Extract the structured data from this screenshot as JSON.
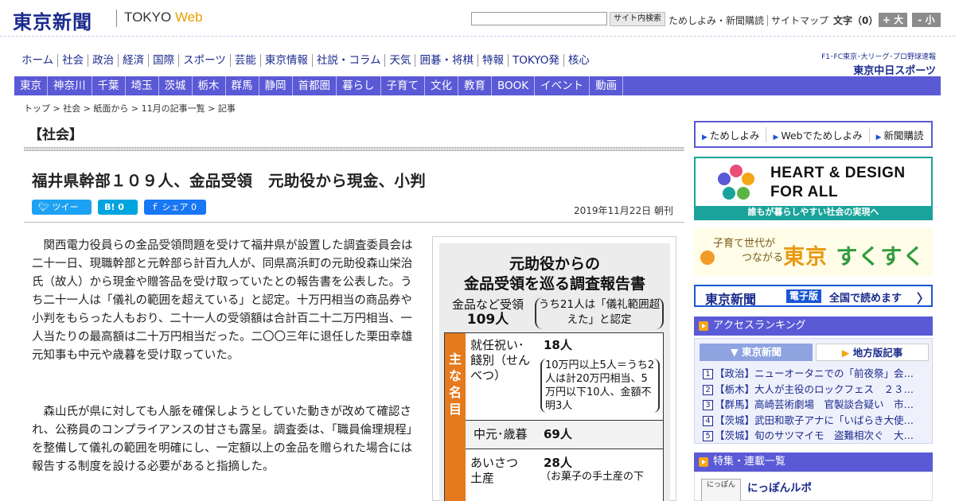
{
  "header": {
    "logo": "東京新聞",
    "logo_sub_left": "TOKYO ",
    "logo_sub_right": "Web",
    "search_placeholder": "",
    "search_button": "サイト内検索",
    "links": [
      "ためしよみ・新聞購読",
      "サイトマップ"
    ],
    "font_size_label": "文字（0）",
    "font_plus": "+ 大",
    "font_minus": "- 小"
  },
  "global_nav": [
    "ホーム",
    "社会",
    "政治",
    "経済",
    "国際",
    "スポーツ",
    "芸能",
    "東京情報",
    "社説・コラム",
    "天気",
    "囲碁・将棋",
    "特報",
    "TOKYO発",
    "核心"
  ],
  "sports_banner": {
    "line1": "F1･FC東京･大リーグ･プロ野球速報",
    "line2": "東京中日スポーツ"
  },
  "regional_nav": [
    "東京",
    "神奈川",
    "千葉",
    "埼玉",
    "茨城",
    "栃木",
    "群馬",
    "静岡",
    "首都圏",
    "暮らし",
    "子育て",
    "文化",
    "教育",
    "BOOK",
    "イベント",
    "動画"
  ],
  "breadcrumb": "トップ > 社会 > 紙面から > 11月の記事一覧 > 記事",
  "article": {
    "section": "【社会】",
    "headline": "福井県幹部１０９人、金品受領　元助役から現金、小判",
    "share": {
      "tweet": "ツイート",
      "hatena": "B! 0",
      "facebook": "シェア 0"
    },
    "date": "2019年11月22日 朝刊",
    "paragraphs": [
      "関西電力役員らの金品受領問題を受けて福井県が設置した調査委員会は二十一日、現職幹部と元幹部ら計百九人が、同県高浜町の元助役森山栄治氏（故人）から現金や贈答品を受け取っていたとの報告書を公表した。うち二十一人は「儀礼の範囲を超えている」と認定。十万円相当の商品券や小判をもらった人もおり、二十一人の受領額は合計百二十二万円相当、一人当たりの最高額は二十万円相当だった。二〇〇三年に退任した栗田幸雄元知事も中元や歳暮を受け取っていた。",
      "森山氏が県に対しても人脈を確保しようとしていた動きが改めて確認され、公務員のコンプライアンスの甘さも露呈。調査委は、「職員倫理規程」を整備して儀礼の範囲を明確にし、一定額以上の金品を贈られた場合には報告する制度を設ける必要があると指摘した。"
    ]
  },
  "figure": {
    "title_line1": "元助役からの",
    "title_line2": "金品受領を巡る調査報告書",
    "total_label": "金品など受領",
    "total_value": "109人",
    "note": "うち21人は「儀礼範囲超えた」と認定",
    "side_label": "主な名目",
    "rows": [
      {
        "label": "就任祝い･餞別（せんべつ）",
        "value": "18人",
        "sub": "10万円以上5人＝うち2人は計20万円相当、5万円以下10人、金額不明3人"
      },
      {
        "label": "中元･歳暮",
        "value": "69人",
        "sub": ""
      },
      {
        "label": "あいさつ土産",
        "value": "28人",
        "sub": "（お菓子の手土産の下"
      }
    ]
  },
  "sidebar": {
    "nav": [
      "ためしよみ",
      "Webでためしよみ",
      "新聞購読"
    ],
    "heart_design": {
      "line1": "HEART & DESIGN",
      "line2": "FOR ALL",
      "tagline": "誰もが暮らしやすい社会の実現へ"
    },
    "sukusuku": {
      "small1": "子育て世代が",
      "small2": "つながる",
      "city": "東京",
      "big": "すくすく"
    },
    "e_paper": {
      "name": "東京新聞",
      "tag": "電子版",
      "text": "全国で読めます",
      "arrow": "〉"
    },
    "ranking": {
      "title": "アクセスランキング",
      "tab_active": "東京新聞",
      "tab_other": "地方版記事",
      "items": [
        "【政治】ニューオータニでの「前夜祭」会…",
        "【栃木】大人が主役のロックフェス　２３…",
        "【群馬】高崎芸術劇場　官製談合疑い　市…",
        "【茨城】武田和歌子アナに「いばらき大使…",
        "【茨城】旬のサツマイモ　盗難相次ぐ　大…"
      ]
    },
    "features": {
      "title": "特集・連載一覧",
      "thumb": "にっぽん",
      "item": "にっぽんルポ"
    }
  },
  "colors": {
    "nav_purple": "#5a59d6",
    "logo_blue": "#1a2a8c",
    "accent_orange": "#e47a1d",
    "teal": "#1aa39a"
  }
}
